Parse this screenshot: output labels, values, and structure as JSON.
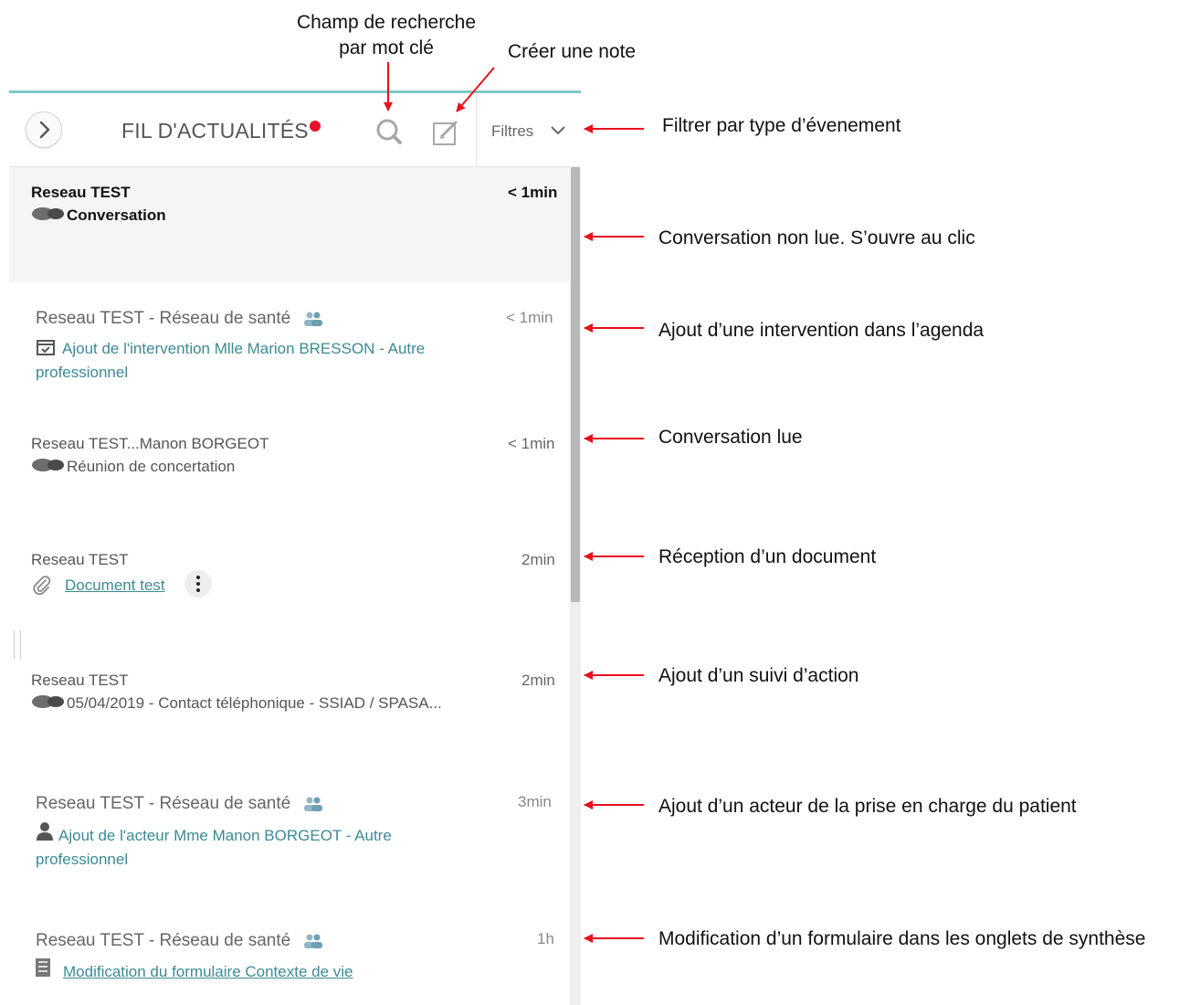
{
  "annotations": {
    "search_field": "Champ de recherche\npar mot clé",
    "create_note": "Créer une note",
    "filter_type": "Filtrer par type d’évenement",
    "unread_conv": "Conversation non lue. S’ouvre au clic",
    "add_intervention": "Ajout d’une intervention dans l’agenda",
    "read_conv": "Conversation lue",
    "doc_received": "Réception d’un document",
    "action_followup": "Ajout d’un suivi d’action",
    "add_actor": "Ajout d’un acteur de la prise en charge du patient",
    "form_modified": "Modification d’un formulaire dans les onglets de synthèse"
  },
  "header": {
    "title": "FIL D'ACTUALITÉS",
    "filters_label": "Filtres",
    "unread_dot_color": "#e8122f"
  },
  "feed": [
    {
      "source": "Reseau TEST",
      "time": "< 1min",
      "icon": "conversation-icon",
      "text": "Conversation",
      "state": "unread"
    },
    {
      "source": "Reseau TEST - Réseau de santé",
      "time": "< 1min",
      "icon": "calendar-check-icon",
      "text_line1": "Ajout de l'intervention Mlle Marion BRESSON - Autre",
      "text_line2": "professionnel",
      "state": "read"
    },
    {
      "source": "Reseau TEST...Manon BORGEOT",
      "time": "< 1min",
      "icon": "conversation-icon",
      "text": "Réunion de concertation",
      "state": "read"
    },
    {
      "source": "Reseau TEST",
      "time": "2min",
      "icon": "paperclip-icon",
      "link": "Document test",
      "state": "read"
    },
    {
      "source": "Reseau TEST",
      "time": "2min",
      "icon": "conversation-icon",
      "text": "05/04/2019 - Contact téléphonique - SSIAD / SPASA...",
      "state": "read"
    },
    {
      "source": "Reseau TEST - Réseau de santé",
      "time": "3min",
      "icon": "person-icon",
      "text_line1": "Ajout de l'acteur Mme Manon BORGEOT - Autre",
      "text_line2": "professionnel",
      "state": "read"
    },
    {
      "source": "Reseau TEST - Réseau de santé",
      "time": "1h",
      "icon": "form-icon",
      "link": "Modification du formulaire Contexte de vie",
      "state": "read"
    }
  ],
  "colors": {
    "accent": "#7ec9c6",
    "link": "#3c8a94",
    "arrow": "#e8101c"
  }
}
